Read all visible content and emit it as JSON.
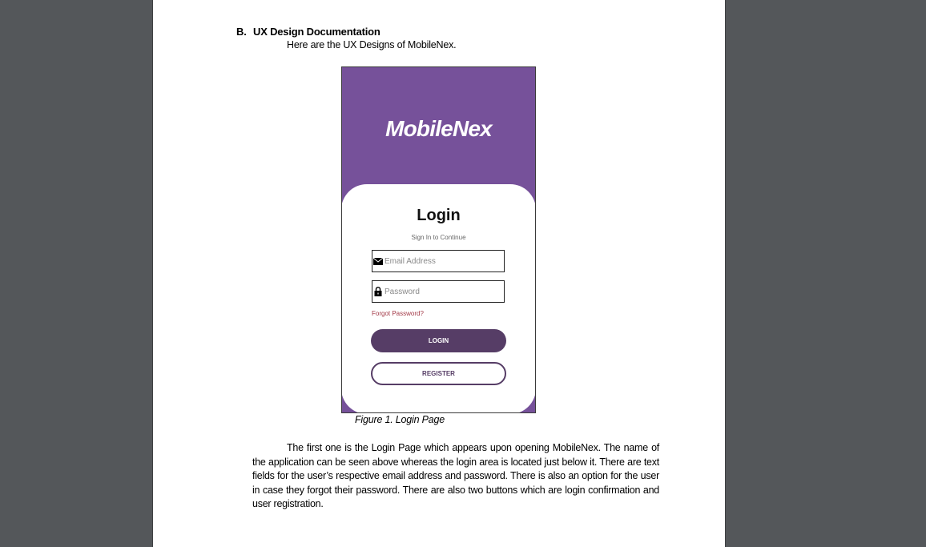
{
  "section": {
    "letter": "B.",
    "title": "UX Design Documentation",
    "intro": "Here are the UX Designs of MobileNex."
  },
  "mockup": {
    "app_name": "MobileNex",
    "login_title": "Login",
    "subtitle": "Sign In to Continue",
    "email_placeholder": "Email Address",
    "password_placeholder": "Password",
    "email_icon": "envelope-icon",
    "password_icon": "lock-icon",
    "forgot_label": "Forgot Password?",
    "login_label": "LOGIN",
    "register_label": "REGISTER",
    "colors": {
      "header": "#76519a",
      "button": "#563d66",
      "forgot": "#a33a48"
    }
  },
  "figure_caption": "Figure 1. Login Page",
  "paragraph": "The first one is the Login Page which appears upon opening MobileNex. The name of the application can be seen above whereas the login area is located just below it. There are text fields for the user’s respective email address and password. There is also an option for the user in case they forgot their password. There are also two buttons which are login confirmation and user registration."
}
